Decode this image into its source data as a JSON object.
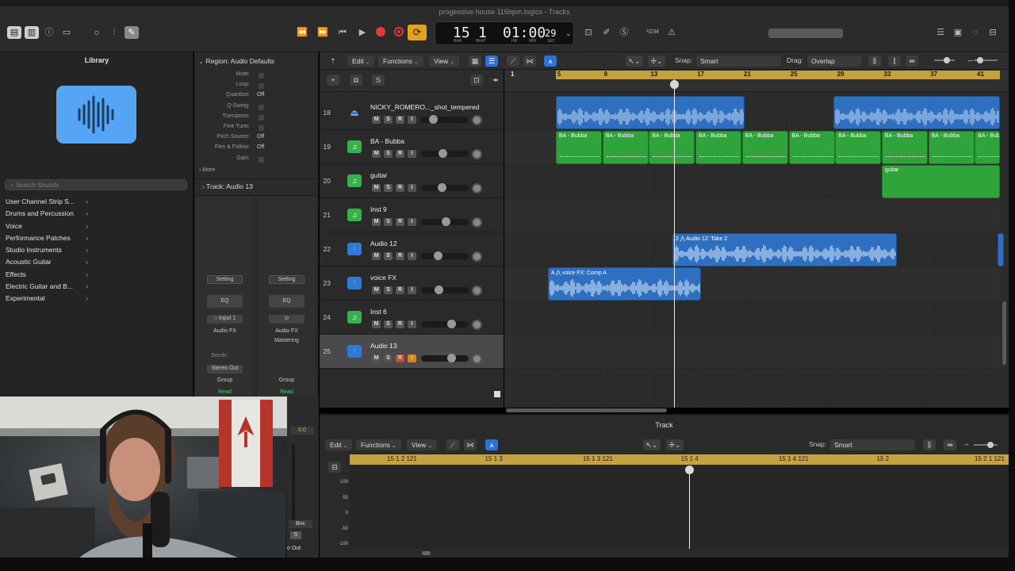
{
  "window": {
    "title": "progessive house 116bpm.logicx - Tracks"
  },
  "lcd": {
    "bar": "15",
    "beat": "1",
    "bar_label": "BAR",
    "beat_label": "BEAT",
    "time": "01:00",
    "time_frac": "29",
    "hr_label": "HR",
    "min_label": "MIN",
    "sec_label": "SEC"
  },
  "toolbar": {
    "key": "¹/234"
  },
  "library": {
    "title": "Library",
    "search_placeholder": "Search Sounds",
    "items": [
      "User Channel Strip S...",
      "Drums and Percussion",
      "Voice",
      "Performance Patches",
      "Studio Instruments",
      "Acoustic Guitar",
      "Effects",
      "Electric Guitar and B...",
      "Experimental"
    ]
  },
  "inspector": {
    "region_header": "Region: Audio Defaults",
    "rows": [
      {
        "k": "Mute:",
        "v": ""
      },
      {
        "k": "Loop:",
        "v": ""
      },
      {
        "k": "Quantize:",
        "v": "Off"
      },
      {
        "k": "Q-Swing:",
        "v": ""
      },
      {
        "k": "Transpose:",
        "v": ""
      },
      {
        "k": "Fine Tune:",
        "v": ""
      },
      {
        "k": "Pitch Source:",
        "v": "Off"
      },
      {
        "k": "Flex & Follow:",
        "v": "Off"
      },
      {
        "k": "Gain:",
        "v": ""
      }
    ],
    "more": "More",
    "track_label": "Track:",
    "track_name": "Audio 13",
    "strip1": {
      "setting": "Setting",
      "eq": "EQ",
      "input": "Input 1",
      "fx": "Audio FX",
      "sends": "Sends",
      "out": "Stereo Out",
      "group": "Group",
      "read": "Read"
    },
    "strip2": {
      "setting": "Setting",
      "eq": "EQ",
      "fx": "Audio FX",
      "fx2": "Mastering",
      "group": "Group",
      "read": "Read",
      "level": "0.0",
      "bnc": "Bnc",
      "s": "S",
      "out": "o Out"
    }
  },
  "tracks_toolbar": {
    "edit": "Edit",
    "functions": "Functions",
    "view": "View",
    "snap_label": "Snap:",
    "snap_value": "Smart",
    "drag_label": "Drag:",
    "drag_value": "Overlap"
  },
  "header_buttons": {
    "add": "+",
    "dup": "⧉",
    "s": "S"
  },
  "ruler_bars": [
    "1",
    "5",
    "9",
    "13",
    "17",
    "21",
    "25",
    "29",
    "33",
    "37",
    "41"
  ],
  "tracks": [
    {
      "num": "18",
      "name": "NICKY_ROMERO..._shot_tempered",
      "type": "ext",
      "fader": 0.2,
      "selected": false
    },
    {
      "num": "19",
      "name": "BA - Bubba",
      "type": "inst",
      "fader": 0.45,
      "selected": false
    },
    {
      "num": "20",
      "name": "guitar",
      "type": "inst",
      "fader": 0.43,
      "selected": false
    },
    {
      "num": "21",
      "name": "Inst 9",
      "type": "inst",
      "fader": 0.53,
      "selected": false
    },
    {
      "num": "22",
      "name": "Audio 12",
      "type": "aud",
      "fader": 0.33,
      "selected": false
    },
    {
      "num": "23",
      "name": "voice FX",
      "type": "aud",
      "fader": 0.35,
      "selected": false
    },
    {
      "num": "24",
      "name": "Inst 6",
      "type": "inst",
      "fader": 0.67,
      "selected": false
    },
    {
      "num": "25",
      "name": "Audio 13",
      "type": "aud",
      "fader": 0.67,
      "selected": true
    }
  ],
  "ms_labels": {
    "m": "M",
    "s": "S",
    "r": "R",
    "i": "I"
  },
  "regions": {
    "bubba": "BA - Bubba",
    "guitar": "guitar",
    "audio12": "2  ⋀ Audio 12: Take 2",
    "voice": "A  ⋀ voice FX: Comp A"
  },
  "editor": {
    "title": "Track",
    "edit": "Edit",
    "functions": "Functions",
    "view": "View",
    "snap_label": "Snap:",
    "snap_value": "Smart",
    "ruler": [
      "15 1 2 121",
      "15 1 3",
      "15 1 3 121",
      "15 1 4",
      "15 1 4 121",
      "15 2",
      "15 2 1 121"
    ],
    "vals": [
      "100",
      "50",
      "0",
      "-50",
      "-100"
    ]
  },
  "colors": {
    "cycle": "#c5a13f",
    "inst_region": "#2ea43a",
    "audio_region": "#2f6fc0",
    "accent": "#2d73d7"
  }
}
